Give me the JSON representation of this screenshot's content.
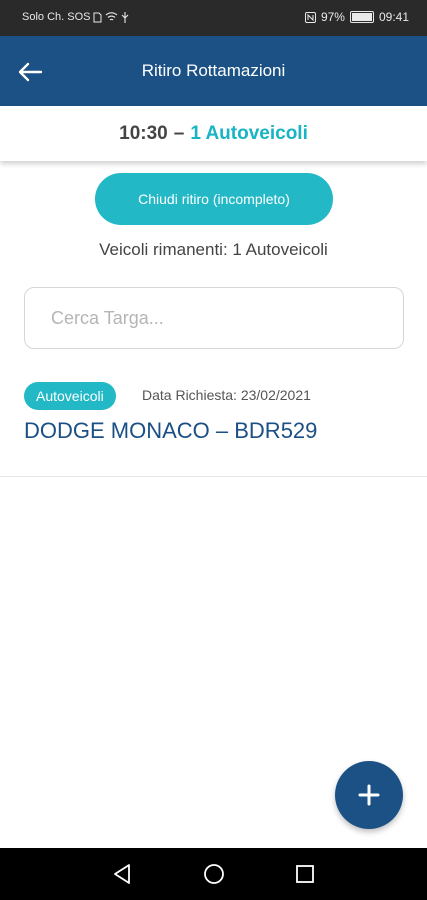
{
  "statusbar": {
    "carrier": "Solo Ch. SOS",
    "battery_percent": "97%",
    "time": "09:41"
  },
  "appbar": {
    "title": "Ritiro Rottamazioni"
  },
  "subheader": {
    "time": "10:30",
    "separator": "–",
    "count": "1 Autoveicoli"
  },
  "actions": {
    "close_pickup_label": "Chiudi ritiro (incompleto)"
  },
  "remaining": {
    "text": "Veicoli rimanenti: 1 Autoveicoli"
  },
  "search": {
    "placeholder": "Cerca Targa..."
  },
  "items": [
    {
      "badge": "Autoveicoli",
      "request_date": "Data Richiesta: 23/02/2021",
      "title": "DODGE MONACO – BDR529"
    }
  ],
  "colors": {
    "primary": "#1b5185",
    "accent": "#22b8c6"
  }
}
